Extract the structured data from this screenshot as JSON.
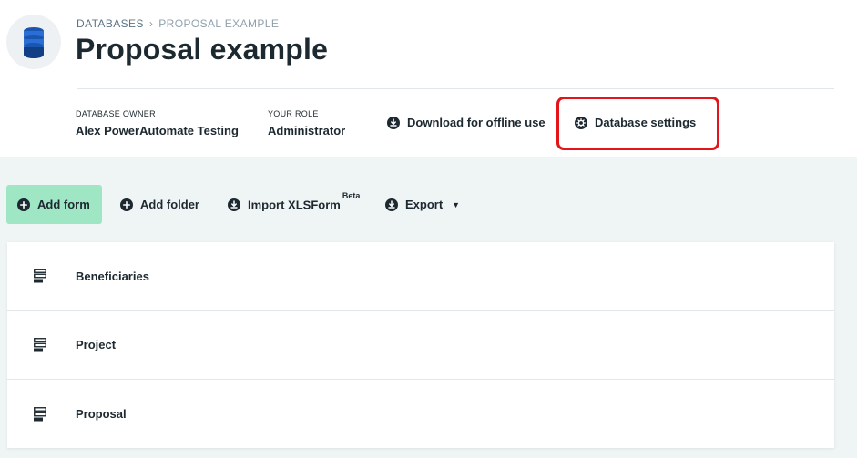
{
  "breadcrumb": {
    "root": "DATABASES",
    "separator": "›",
    "current": "PROPOSAL EXAMPLE"
  },
  "page": {
    "title": "Proposal example",
    "icon": "database-icon"
  },
  "meta": {
    "owner_label": "DATABASE OWNER",
    "owner_value": "Alex PowerAutomate Testing",
    "role_label": "YOUR ROLE",
    "role_value": "Administrator"
  },
  "actions": {
    "download_label": "Download for offline use",
    "download_icon": "download-icon",
    "settings_label": "Database settings",
    "settings_icon": "gear-icon"
  },
  "toolbar": {
    "add_form_label": "Add form",
    "add_folder_label": "Add folder",
    "import_label": "Import XLSForm",
    "import_badge": "Beta",
    "export_label": "Export",
    "export_caret": "▼"
  },
  "forms": [
    {
      "label": "Beneficiaries",
      "icon": "form-icon"
    },
    {
      "label": "Project",
      "icon": "form-icon"
    },
    {
      "label": "Proposal",
      "icon": "form-icon"
    }
  ],
  "colors": {
    "primary_text": "#1d2930",
    "add_form_bg": "#9ee6c4",
    "band_bg": "#eff4f5",
    "highlight": "#e3151a",
    "db_icon": "#1a56b0"
  }
}
